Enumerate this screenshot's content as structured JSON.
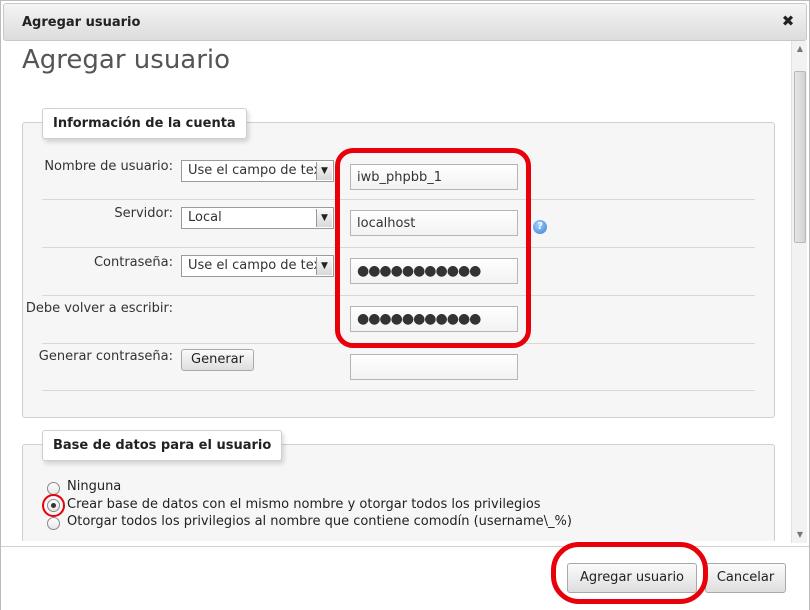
{
  "dialog": {
    "title": "Agregar usuario",
    "close_glyph": "✖",
    "heading": "Agregar usuario"
  },
  "account": {
    "legend": "Información de la cuenta",
    "username_label": "Nombre de usuario:",
    "username_select": "Use el campo de texto",
    "username_value": "iwb_phpbb_1",
    "server_label": "Servidor:",
    "server_select": "Local",
    "server_value": "localhost",
    "password_label": "Contraseña:",
    "password_select": "Use el campo de texto",
    "password_value": "●●●●●●●●●●●",
    "retype_label": "Debe volver a escribir:",
    "retype_value": "●●●●●●●●●●●",
    "generate_label": "Generar contraseña:",
    "generate_button": "Generar",
    "generate_value": ""
  },
  "database": {
    "legend": "Base de datos para el usuario",
    "options": [
      {
        "label": "Ninguna",
        "checked": false
      },
      {
        "label": "Crear base de datos con el mismo nombre y otorgar todos los privilegios",
        "checked": true
      },
      {
        "label": "Otorgar todos los privilegios al nombre que contiene comodín (username\\_%)",
        "checked": false
      }
    ]
  },
  "footer": {
    "submit_label": "Agregar usuario",
    "cancel_label": "Cancelar"
  },
  "icons": {
    "help": "?",
    "dropdown": "▼",
    "scroll_up": "▲",
    "scroll_down": "▼"
  },
  "colors": {
    "annotation_red": "#e8000b"
  }
}
